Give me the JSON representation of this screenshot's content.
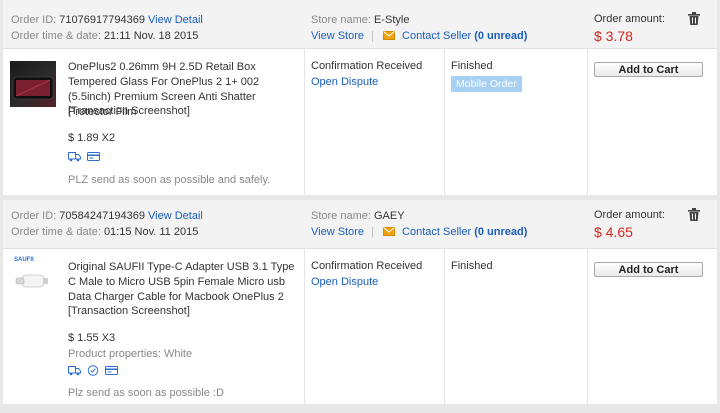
{
  "labels": {
    "order_id": "Order ID:",
    "order_time": "Order time & date:",
    "view_detail": "View Detail",
    "store_name": "Store name:",
    "view_store": "View Store",
    "separator": "|",
    "contact_seller": "Contact Seller",
    "order_amount": "Order amount:",
    "add_to_cart": "Add to Cart",
    "open_dispute": "Open Dispute"
  },
  "orders": [
    {
      "id": "71076917794369",
      "datetime": "21:11 Nov. 18 2015",
      "store": "E-Style",
      "unread": "(0 unread)",
      "amount": "$ 3.78",
      "product_title": "OnePlus2 0.26mm 9H 2.5D Retail Box Tempered Glass For OnePlus 2 1+ 002 (5.5inch) Premium Screen Anti Shatter Protector Film",
      "snapshot": "[Transaction Screenshot]",
      "price_qty": "$ 1.89 X2",
      "note": "PLZ send as soon as possible and safely.",
      "icons": [
        "shipping-truck-icon",
        "card-icon"
      ],
      "status": "Confirmation Received",
      "finish": "Finished",
      "badge": "Mobile Order"
    },
    {
      "id": "70584247194369",
      "datetime": "01:15 Nov. 11 2015",
      "store": "GAEY",
      "unread": "(0 unread)",
      "amount": "$ 4.65",
      "product_title": "Original SAUFII Type-C Adapter USB 3.1 Type C Male to Micro USB 5pin Female Micro usb Data Charger Cable for Macbook OnePlus 2",
      "snapshot": "[Transaction Screenshot]",
      "price_qty": "$ 1.55 X3",
      "properties": "Product properties: White",
      "note": "Plz send as soon as possible :D",
      "icons": [
        "shipping-truck-icon",
        "refresh-circle-icon",
        "card-icon"
      ],
      "status": "Confirmation Received",
      "finish": "Finished",
      "thumb_label": "SAUFII"
    }
  ],
  "colors": {
    "link": "#1a5ebd",
    "amount": "#d0281c",
    "badge": "#a6d1f4",
    "envelope": "#f0a30a"
  }
}
